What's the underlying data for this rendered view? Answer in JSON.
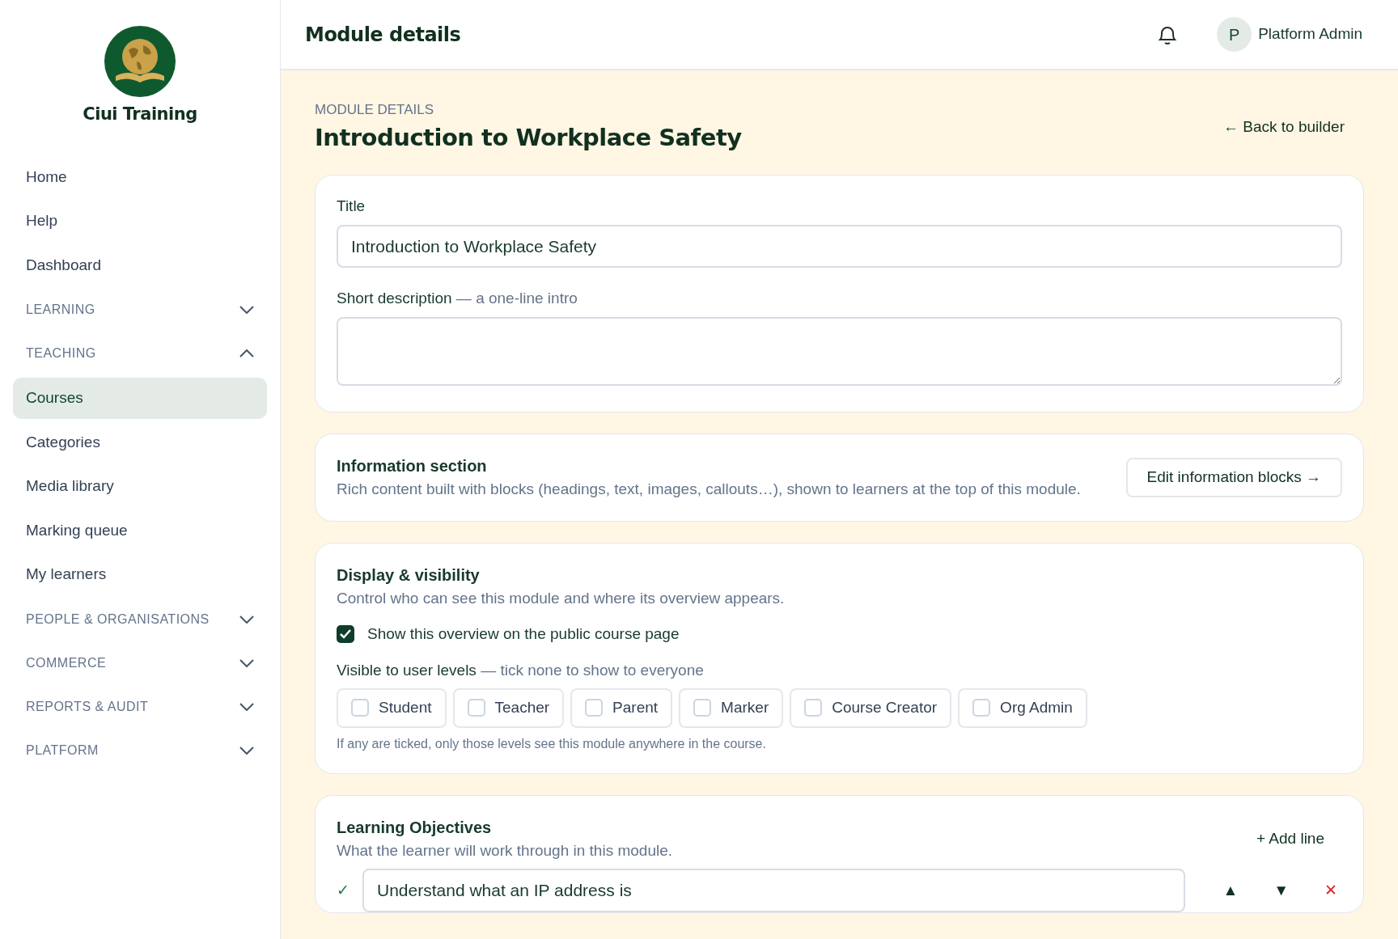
{
  "brand": {
    "name": "Ciui Training"
  },
  "sidebar": {
    "items": [
      {
        "kind": "link",
        "label": "Home",
        "selected": false
      },
      {
        "kind": "link",
        "label": "Help",
        "selected": false
      },
      {
        "kind": "link",
        "label": "Dashboard",
        "selected": false
      },
      {
        "kind": "section",
        "label": "LEARNING",
        "expanded": false
      },
      {
        "kind": "section",
        "label": "TEACHING",
        "expanded": true,
        "children": [
          {
            "kind": "link",
            "label": "Courses",
            "selected": true
          },
          {
            "kind": "link",
            "label": "Categories",
            "selected": false
          },
          {
            "kind": "link",
            "label": "Media library",
            "selected": false
          },
          {
            "kind": "link",
            "label": "Marking queue",
            "selected": false
          },
          {
            "kind": "link",
            "label": "My learners",
            "selected": false
          }
        ]
      },
      {
        "kind": "section",
        "label": "PEOPLE & ORGANISATIONS",
        "expanded": false
      },
      {
        "kind": "section",
        "label": "COMMERCE",
        "expanded": false
      },
      {
        "kind": "section",
        "label": "REPORTS & AUDIT",
        "expanded": false
      },
      {
        "kind": "section",
        "label": "PLATFORM",
        "expanded": false
      }
    ]
  },
  "header": {
    "title": "Module details",
    "user": {
      "initial": "P",
      "name": "Platform Admin"
    }
  },
  "page": {
    "eyebrow": "MODULE DETAILS",
    "title": "Introduction to Workplace Safety",
    "back_link": "← Back to builder"
  },
  "basics": {
    "title_label": "Title",
    "title_value": "Introduction to Workplace Safety",
    "description_label": "Short description",
    "description_hint": "— a one-line intro"
  },
  "information": {
    "heading": "Information section",
    "text": "Rich content built with blocks (headings, text, images, callouts…), shown to learners at the top of this module.",
    "button": "Edit information blocks →"
  },
  "display": {
    "heading": "Display & visibility",
    "text": "Control who can see this module and where its overview appears.",
    "public_overview": {
      "label": "Show this overview on the public course page",
      "checked": true
    },
    "levels_label": "Visible to user levels",
    "levels_hint": "— tick none to show to everyone",
    "levels": [
      {
        "label": "Student",
        "checked": false
      },
      {
        "label": "Teacher",
        "checked": false
      },
      {
        "label": "Parent",
        "checked": false
      },
      {
        "label": "Marker",
        "checked": false
      },
      {
        "label": "Course Creator",
        "checked": false
      },
      {
        "label": "Org Admin",
        "checked": false
      }
    ],
    "footnote": "If any are ticked, only those levels see this module anywhere in the course."
  },
  "objectives": {
    "heading": "Learning Objectives",
    "text": "What the learner will work through in this module.",
    "add_button": "+ Add line",
    "lines": [
      {
        "mark": "✓",
        "value": "Understand what an IP address is",
        "up": "▲",
        "down": "▼",
        "remove": "✕"
      }
    ]
  }
}
